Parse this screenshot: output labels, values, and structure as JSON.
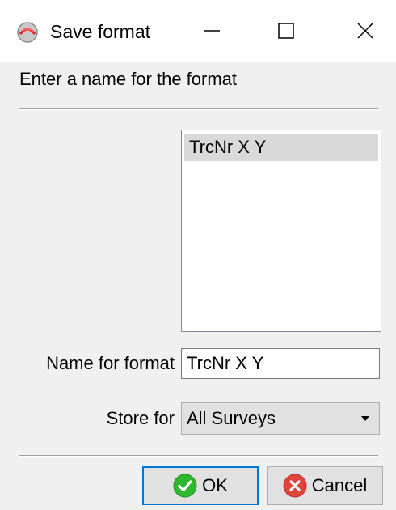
{
  "window": {
    "title": "Save format"
  },
  "titlebar": {
    "minimize_icon": "minimize-icon",
    "maximize_icon": "maximize-icon",
    "close_icon": "close-icon"
  },
  "dialog": {
    "prompt": "Enter a name for the format",
    "list_items": [
      "TrcNr X Y"
    ],
    "name_label": "Name for format",
    "name_value": "TrcNr X Y",
    "store_label": "Store for",
    "store_value": "All Surveys"
  },
  "buttons": {
    "ok_label": "OK",
    "cancel_label": "Cancel"
  },
  "colors": {
    "ok_icon": "#2eb82e",
    "cancel_icon": "#e0443a",
    "focus_border": "#0078d7",
    "selected_item": "#d9d9d9"
  }
}
